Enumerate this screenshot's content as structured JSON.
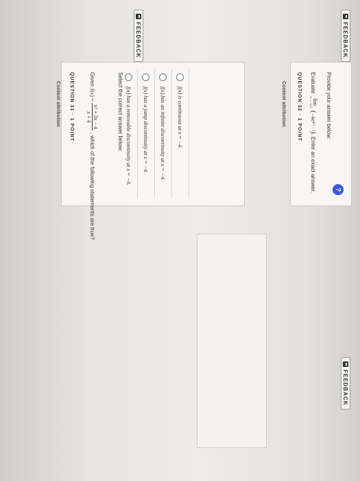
{
  "top_feedback_label": "FEEDBACK",
  "content_attribution_1": "Content attribution",
  "question31": {
    "header": "QUESTION 31 · 1 POINT",
    "given_prefix": "Given",
    "given_function": "f(x) =",
    "numerator": "x² + 3x − 4",
    "denominator": "x + 4",
    "question_suffix": ", which of the following statements are true?",
    "instruction": "Select the correct answer below:",
    "options": [
      "f(x) has a removable discontinuity at x = −4.",
      "f(x) has a jump discontinuity at x = −4.",
      "f(x) has an infinite discontinuity at x = −4.",
      "f(x) is continuous at x = −4."
    ],
    "feedback_label": "FEEDBACK"
  },
  "content_attribution_2": "Content attribution",
  "question32": {
    "header": "QUESTION 32 · 1 POINT",
    "evaluate_prefix": "Evaluate",
    "limit_word": "lim",
    "limit_sub": "x→−1/2",
    "expression": "(−4e^(4x²−1))",
    "exponent_display": "4x² − 1",
    "suffix": ". Enter an exact answer.",
    "answer_prompt": "Provide your answer below:",
    "answer_value": "",
    "feedback_label": "FEEDBACK"
  },
  "help_icon_glyph": "?"
}
